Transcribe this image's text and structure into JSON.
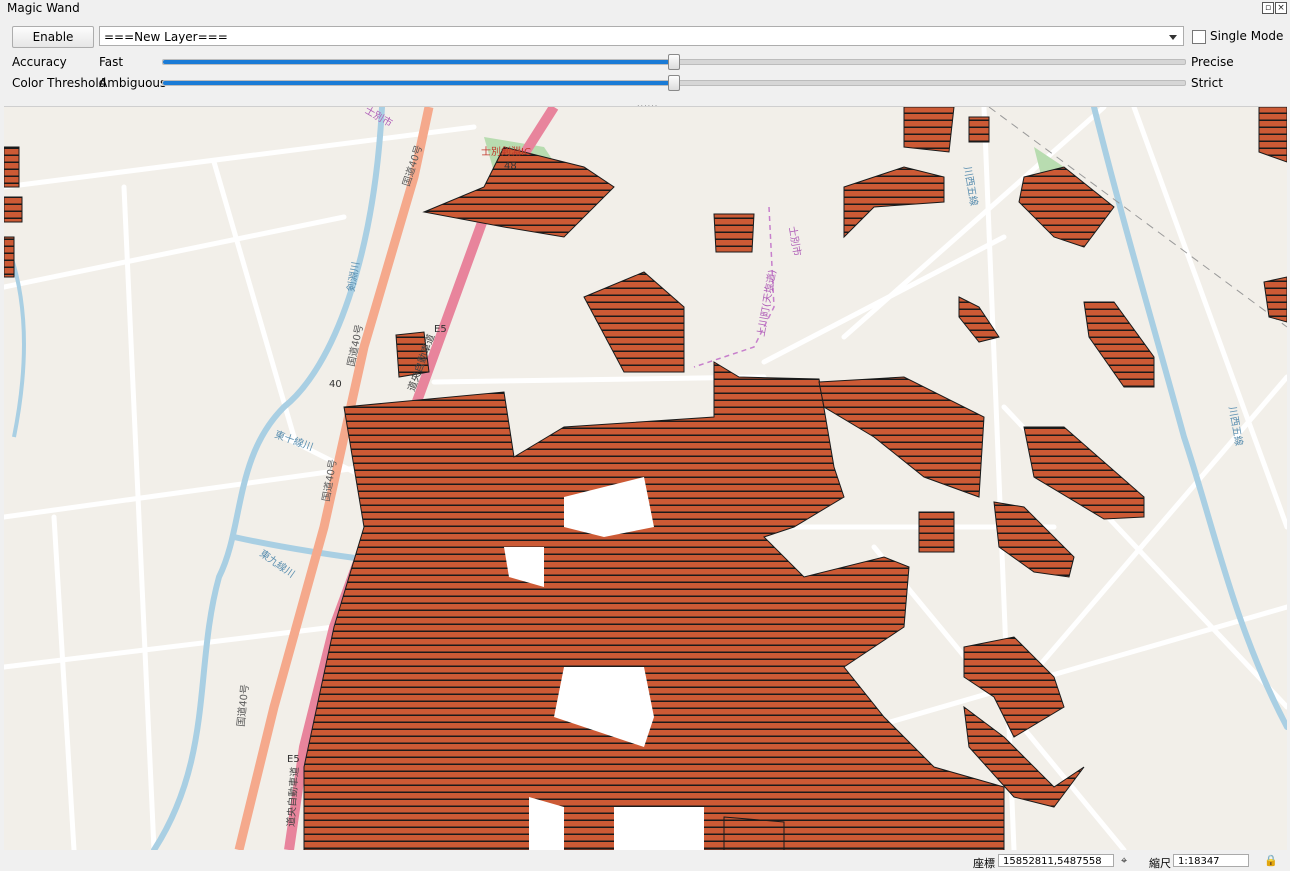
{
  "window": {
    "title": "Magic Wand"
  },
  "toolbar": {
    "enable_label": "Enable",
    "layer_value": "===New Layer===",
    "single_mode_label": "Single Mode",
    "single_mode_checked": false
  },
  "sliders": [
    {
      "label": "Accuracy",
      "left_label": "Fast",
      "right_label": "Precise",
      "value_fraction": 0.5
    },
    {
      "label": "Color Threshold",
      "left_label": "Ambiguous",
      "right_label": "Strict",
      "value_fraction": 0.5
    }
  ],
  "map": {
    "road_labels": [
      "国道40号",
      "国道40号",
      "国道40号",
      "国道40号",
      "道央自動車道",
      "道央自動車道",
      "E5",
      "E5",
      "40",
      "48",
      "士別剣淵IC",
      "剣淵川",
      "東十線川",
      "東九線川",
      "川西五線",
      "川西五線",
      "上川町(天塩道)",
      "士別市",
      "士別市"
    ],
    "colors": {
      "background": "#f2efe9",
      "road": "#ffffff",
      "primary_road": "#f5a98c",
      "motorway": "#e8849c",
      "river": "#a9cfe3",
      "park": "#b8dcb0",
      "highlight_fill": "#cc5a35",
      "highlight_stripe": "#1a1a1a"
    }
  },
  "status": {
    "coord_label": "座標",
    "coord_value": "15852811,5487558",
    "scale_label": "縮尺",
    "scale_value": "1:18347"
  }
}
